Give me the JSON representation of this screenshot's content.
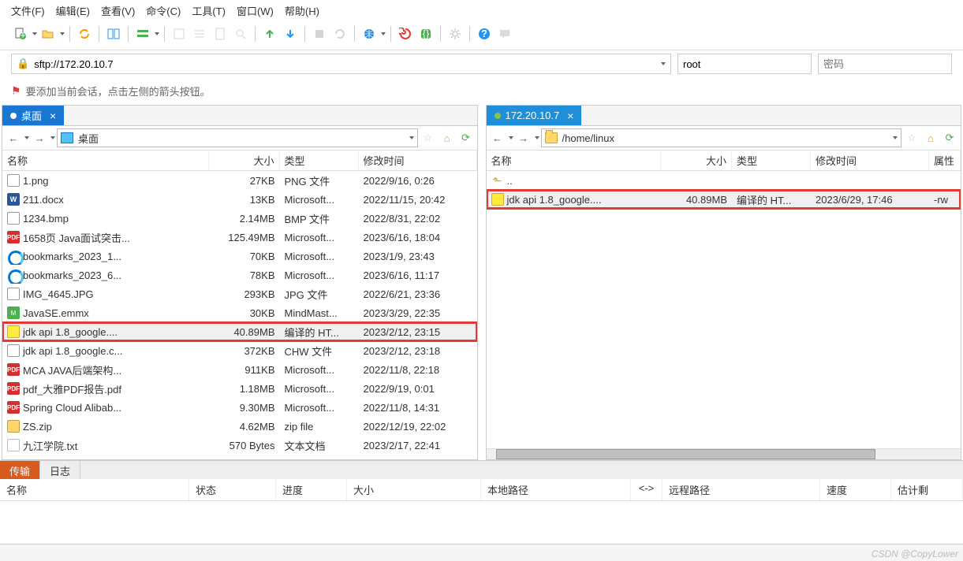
{
  "menu": {
    "file": "文件(F)",
    "edit": "编辑(E)",
    "view": "查看(V)",
    "cmd": "命令(C)",
    "tools": "工具(T)",
    "window": "窗口(W)",
    "help": "帮助(H)"
  },
  "address": {
    "scheme_icon": "lock",
    "url": "sftp://172.20.10.7",
    "user": "root",
    "pass_placeholder": "密码"
  },
  "hint": "要添加当前会话，点击左侧的箭头按钮。",
  "left_pane": {
    "tab": "桌面",
    "path_label": "桌面",
    "columns": {
      "name": "名称",
      "size": "大小",
      "type": "类型",
      "date": "修改时间"
    },
    "rows": [
      {
        "icon": "png",
        "name": "1.png",
        "size": "27KB",
        "type": "PNG 文件",
        "date": "2022/9/16, 0:26"
      },
      {
        "icon": "word",
        "name": "211.docx",
        "size": "13KB",
        "type": "Microsoft...",
        "date": "2022/11/15, 20:42"
      },
      {
        "icon": "bmp",
        "name": "1234.bmp",
        "size": "2.14MB",
        "type": "BMP 文件",
        "date": "2022/8/31, 22:02"
      },
      {
        "icon": "pdf",
        "name": "1658页 Java面试突击...",
        "size": "125.49MB",
        "type": "Microsoft...",
        "date": "2023/6/16, 18:04"
      },
      {
        "icon": "edge",
        "name": "bookmarks_2023_1...",
        "size": "70KB",
        "type": "Microsoft...",
        "date": "2023/1/9, 23:43"
      },
      {
        "icon": "edge",
        "name": "bookmarks_2023_6...",
        "size": "78KB",
        "type": "Microsoft...",
        "date": "2023/6/16, 11:17"
      },
      {
        "icon": "jpg",
        "name": "IMG_4645.JPG",
        "size": "293KB",
        "type": "JPG 文件",
        "date": "2022/6/21, 23:36"
      },
      {
        "icon": "mm",
        "name": "JavaSE.emmx",
        "size": "30KB",
        "type": "MindMast...",
        "date": "2023/3/29, 22:35"
      },
      {
        "icon": "chm",
        "name": "jdk api 1.8_google....",
        "size": "40.89MB",
        "type": "编译的 HT...",
        "date": "2023/2/12, 23:15",
        "hl": true
      },
      {
        "icon": "chw",
        "name": "jdk api 1.8_google.c...",
        "size": "372KB",
        "type": "CHW 文件",
        "date": "2023/2/12, 23:18"
      },
      {
        "icon": "pdf",
        "name": "MCA JAVA后端架构...",
        "size": "911KB",
        "type": "Microsoft...",
        "date": "2022/11/8, 22:18"
      },
      {
        "icon": "pdf",
        "name": "pdf_大雅PDF报告.pdf",
        "size": "1.18MB",
        "type": "Microsoft...",
        "date": "2022/9/19, 0:01"
      },
      {
        "icon": "pdf",
        "name": "Spring Cloud Alibab...",
        "size": "9.30MB",
        "type": "Microsoft...",
        "date": "2022/11/8, 14:31"
      },
      {
        "icon": "zip",
        "name": "ZS.zip",
        "size": "4.62MB",
        "type": "zip file",
        "date": "2022/12/19, 22:02"
      },
      {
        "icon": "txt",
        "name": "九江学院.txt",
        "size": "570 Bytes",
        "type": "文本文档",
        "date": "2023/2/17, 22:41"
      }
    ]
  },
  "right_pane": {
    "tab": "172.20.10.7",
    "path_label": "/home/linux",
    "columns": {
      "name": "名称",
      "size": "大小",
      "type": "类型",
      "date": "修改时间",
      "attr": "属性"
    },
    "rows": [
      {
        "icon": "up",
        "name": "..",
        "size": "",
        "type": "",
        "date": "",
        "attr": ""
      },
      {
        "icon": "chm",
        "name": "jdk api 1.8_google....",
        "size": "40.89MB",
        "type": "编译的 HT...",
        "date": "2023/6/29, 17:46",
        "attr": "-rw",
        "hl": true
      }
    ]
  },
  "bottom": {
    "transfer": "传输",
    "log": "日志"
  },
  "transfer_cols": {
    "name": "名称",
    "status": "状态",
    "progress": "进度",
    "size": "大小",
    "local": "本地路径",
    "dir": "<->",
    "remote": "远程路径",
    "speed": "速度",
    "eta": "估计剩"
  },
  "watermark": "CSDN @CopyLower"
}
